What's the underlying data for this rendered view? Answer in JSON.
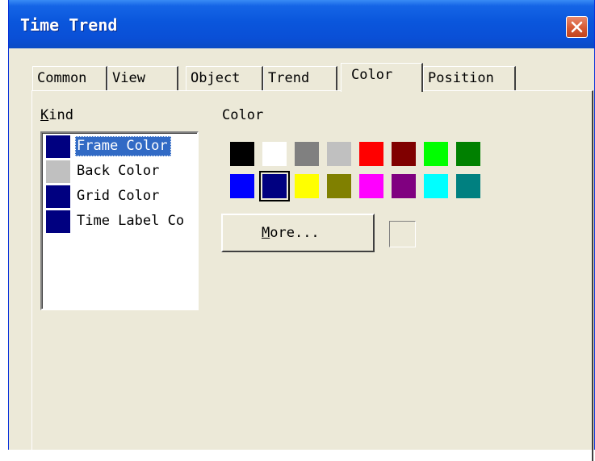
{
  "window": {
    "title": "Time Trend",
    "close_icon": "close-icon"
  },
  "tabs": [
    {
      "label": "Common",
      "active": false
    },
    {
      "label": "View",
      "active": false
    },
    {
      "label": "Object",
      "active": false
    },
    {
      "label": "Trend",
      "active": false
    },
    {
      "label": "Color",
      "active": true
    },
    {
      "label": "Position",
      "active": false
    }
  ],
  "kind": {
    "label_prefix": "K",
    "label_rest": "ind",
    "items": [
      {
        "label": "Frame Color",
        "color": "#000080",
        "selected": true
      },
      {
        "label": "Back Color",
        "color": "#c0c0c0",
        "selected": false
      },
      {
        "label": "Grid Color",
        "color": "#000080",
        "selected": false
      },
      {
        "label": "Time Label Co",
        "color": "#000080",
        "selected": false
      }
    ]
  },
  "color": {
    "label": "Color",
    "palette_row1": [
      "#000000",
      "#ffffff",
      "#808080",
      "#c0c0c0",
      "#ff0000",
      "#800000",
      "#00ff00",
      "#008000"
    ],
    "palette_row2": [
      "#0000ff",
      "#000080",
      "#ffff00",
      "#808000",
      "#ff00ff",
      "#800080",
      "#00ffff",
      "#008080"
    ],
    "selected_color": "#000080",
    "more_prefix": "M",
    "more_rest": "ore..."
  }
}
